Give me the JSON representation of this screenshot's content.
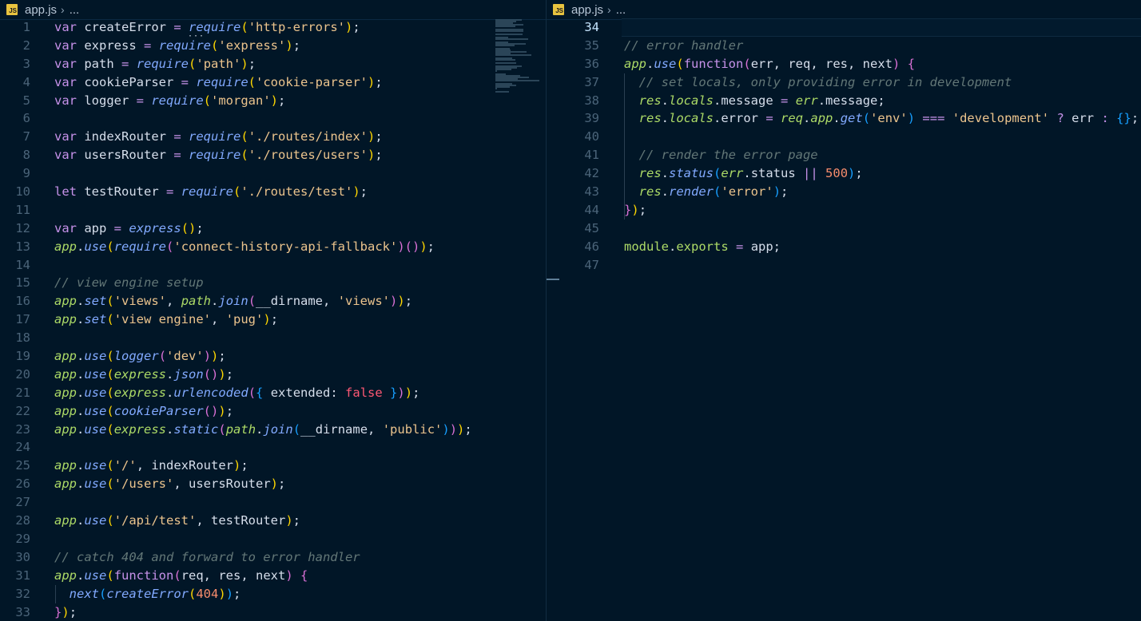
{
  "left_pane": {
    "breadcrumb": {
      "file": "app.js",
      "badge": "JS",
      "more": "..."
    },
    "first_line_number": 1,
    "lines": [
      [
        [
          "kw",
          "var"
        ],
        [
          "var",
          " createError "
        ],
        [
          "op",
          "="
        ],
        [
          "var",
          " "
        ],
        [
          "fn",
          "require"
        ],
        [
          "p1",
          "("
        ],
        [
          "str",
          "'http-errors'"
        ],
        [
          "p1",
          ")"
        ],
        [
          "var",
          ";"
        ]
      ],
      [
        [
          "kw",
          "var"
        ],
        [
          "var",
          " express "
        ],
        [
          "op",
          "="
        ],
        [
          "var",
          " "
        ],
        [
          "fn",
          "require"
        ],
        [
          "p1",
          "("
        ],
        [
          "str",
          "'express'"
        ],
        [
          "p1",
          ")"
        ],
        [
          "var",
          ";"
        ]
      ],
      [
        [
          "kw",
          "var"
        ],
        [
          "var",
          " path "
        ],
        [
          "op",
          "="
        ],
        [
          "var",
          " "
        ],
        [
          "fn",
          "require"
        ],
        [
          "p1",
          "("
        ],
        [
          "str",
          "'path'"
        ],
        [
          "p1",
          ")"
        ],
        [
          "var",
          ";"
        ]
      ],
      [
        [
          "kw",
          "var"
        ],
        [
          "var",
          " cookieParser "
        ],
        [
          "op",
          "="
        ],
        [
          "var",
          " "
        ],
        [
          "fn",
          "require"
        ],
        [
          "p1",
          "("
        ],
        [
          "str",
          "'cookie-parser'"
        ],
        [
          "p1",
          ")"
        ],
        [
          "var",
          ";"
        ]
      ],
      [
        [
          "kw",
          "var"
        ],
        [
          "var",
          " logger "
        ],
        [
          "op",
          "="
        ],
        [
          "var",
          " "
        ],
        [
          "fn",
          "require"
        ],
        [
          "p1",
          "("
        ],
        [
          "str",
          "'morgan'"
        ],
        [
          "p1",
          ")"
        ],
        [
          "var",
          ";"
        ]
      ],
      [],
      [
        [
          "kw",
          "var"
        ],
        [
          "var",
          " indexRouter "
        ],
        [
          "op",
          "="
        ],
        [
          "var",
          " "
        ],
        [
          "fn",
          "require"
        ],
        [
          "p1",
          "("
        ],
        [
          "str",
          "'./routes/index'"
        ],
        [
          "p1",
          ")"
        ],
        [
          "var",
          ";"
        ]
      ],
      [
        [
          "kw",
          "var"
        ],
        [
          "var",
          " usersRouter "
        ],
        [
          "op",
          "="
        ],
        [
          "var",
          " "
        ],
        [
          "fn",
          "require"
        ],
        [
          "p1",
          "("
        ],
        [
          "str",
          "'./routes/users'"
        ],
        [
          "p1",
          ")"
        ],
        [
          "var",
          ";"
        ]
      ],
      [],
      [
        [
          "kw",
          "let"
        ],
        [
          "var",
          " testRouter "
        ],
        [
          "op",
          "="
        ],
        [
          "var",
          " "
        ],
        [
          "fn",
          "require"
        ],
        [
          "p1",
          "("
        ],
        [
          "str",
          "'./routes/test'"
        ],
        [
          "p1",
          ")"
        ],
        [
          "var",
          ";"
        ]
      ],
      [],
      [
        [
          "kw",
          "var"
        ],
        [
          "var",
          " app "
        ],
        [
          "op",
          "="
        ],
        [
          "var",
          " "
        ],
        [
          "fn",
          "express"
        ],
        [
          "p1",
          "()"
        ],
        [
          "var",
          ";"
        ]
      ],
      [
        [
          "obj",
          "app"
        ],
        [
          "var",
          "."
        ],
        [
          "fn",
          "use"
        ],
        [
          "p1",
          "("
        ],
        [
          "fn",
          "require"
        ],
        [
          "p2",
          "("
        ],
        [
          "str",
          "'connect-history-api-fallback'"
        ],
        [
          "p2",
          ")()"
        ],
        [
          "p1",
          ")"
        ],
        [
          "var",
          ";"
        ]
      ],
      [],
      [
        [
          "cm",
          "// view engine setup"
        ]
      ],
      [
        [
          "obj",
          "app"
        ],
        [
          "var",
          "."
        ],
        [
          "fn",
          "set"
        ],
        [
          "p1",
          "("
        ],
        [
          "str",
          "'views'"
        ],
        [
          "var",
          ", "
        ],
        [
          "obj",
          "path"
        ],
        [
          "var",
          "."
        ],
        [
          "fn",
          "join"
        ],
        [
          "p2",
          "("
        ],
        [
          "var",
          "__dirname, "
        ],
        [
          "str",
          "'views'"
        ],
        [
          "p2",
          ")"
        ],
        [
          "p1",
          ")"
        ],
        [
          "var",
          ";"
        ]
      ],
      [
        [
          "obj",
          "app"
        ],
        [
          "var",
          "."
        ],
        [
          "fn",
          "set"
        ],
        [
          "p1",
          "("
        ],
        [
          "str",
          "'view engine'"
        ],
        [
          "var",
          ", "
        ],
        [
          "str",
          "'pug'"
        ],
        [
          "p1",
          ")"
        ],
        [
          "var",
          ";"
        ]
      ],
      [],
      [
        [
          "obj",
          "app"
        ],
        [
          "var",
          "."
        ],
        [
          "fn",
          "use"
        ],
        [
          "p1",
          "("
        ],
        [
          "fn",
          "logger"
        ],
        [
          "p2",
          "("
        ],
        [
          "str",
          "'dev'"
        ],
        [
          "p2",
          ")"
        ],
        [
          "p1",
          ")"
        ],
        [
          "var",
          ";"
        ]
      ],
      [
        [
          "obj",
          "app"
        ],
        [
          "var",
          "."
        ],
        [
          "fn",
          "use"
        ],
        [
          "p1",
          "("
        ],
        [
          "obj",
          "express"
        ],
        [
          "var",
          "."
        ],
        [
          "fn",
          "json"
        ],
        [
          "p2",
          "()"
        ],
        [
          "p1",
          ")"
        ],
        [
          "var",
          ";"
        ]
      ],
      [
        [
          "obj",
          "app"
        ],
        [
          "var",
          "."
        ],
        [
          "fn",
          "use"
        ],
        [
          "p1",
          "("
        ],
        [
          "obj",
          "express"
        ],
        [
          "var",
          "."
        ],
        [
          "fn",
          "urlencoded"
        ],
        [
          "p2",
          "("
        ],
        [
          "p3",
          "{"
        ],
        [
          "var",
          " extended: "
        ],
        [
          "bool",
          "false"
        ],
        [
          "var",
          " "
        ],
        [
          "p3",
          "}"
        ],
        [
          "p2",
          ")"
        ],
        [
          "p1",
          ")"
        ],
        [
          "var",
          ";"
        ]
      ],
      [
        [
          "obj",
          "app"
        ],
        [
          "var",
          "."
        ],
        [
          "fn",
          "use"
        ],
        [
          "p1",
          "("
        ],
        [
          "fn",
          "cookieParser"
        ],
        [
          "p2",
          "()"
        ],
        [
          "p1",
          ")"
        ],
        [
          "var",
          ";"
        ]
      ],
      [
        [
          "obj",
          "app"
        ],
        [
          "var",
          "."
        ],
        [
          "fn",
          "use"
        ],
        [
          "p1",
          "("
        ],
        [
          "obj",
          "express"
        ],
        [
          "var",
          "."
        ],
        [
          "fn",
          "static"
        ],
        [
          "p2",
          "("
        ],
        [
          "obj",
          "path"
        ],
        [
          "var",
          "."
        ],
        [
          "fn",
          "join"
        ],
        [
          "p3",
          "("
        ],
        [
          "var",
          "__dirname, "
        ],
        [
          "str",
          "'public'"
        ],
        [
          "p3",
          ")"
        ],
        [
          "p2",
          ")"
        ],
        [
          "p1",
          ")"
        ],
        [
          "var",
          ";"
        ]
      ],
      [],
      [
        [
          "obj",
          "app"
        ],
        [
          "var",
          "."
        ],
        [
          "fn",
          "use"
        ],
        [
          "p1",
          "("
        ],
        [
          "str",
          "'/'"
        ],
        [
          "var",
          ", indexRouter"
        ],
        [
          "p1",
          ")"
        ],
        [
          "var",
          ";"
        ]
      ],
      [
        [
          "obj",
          "app"
        ],
        [
          "var",
          "."
        ],
        [
          "fn",
          "use"
        ],
        [
          "p1",
          "("
        ],
        [
          "str",
          "'/users'"
        ],
        [
          "var",
          ", usersRouter"
        ],
        [
          "p1",
          ")"
        ],
        [
          "var",
          ";"
        ]
      ],
      [],
      [
        [
          "obj",
          "app"
        ],
        [
          "var",
          "."
        ],
        [
          "fn",
          "use"
        ],
        [
          "p1",
          "("
        ],
        [
          "str",
          "'/api/test'"
        ],
        [
          "var",
          ", testRouter"
        ],
        [
          "p1",
          ")"
        ],
        [
          "var",
          ";"
        ]
      ],
      [],
      [
        [
          "cm",
          "// catch 404 and forward to error handler"
        ]
      ],
      [
        [
          "obj",
          "app"
        ],
        [
          "var",
          "."
        ],
        [
          "fn",
          "use"
        ],
        [
          "p1",
          "("
        ],
        [
          "kw",
          "function"
        ],
        [
          "p2",
          "("
        ],
        [
          "var",
          "req, res, next"
        ],
        [
          "p2",
          ")"
        ],
        [
          "var",
          " "
        ],
        [
          "p2",
          "{"
        ]
      ],
      [
        [
          "var",
          "  "
        ],
        [
          "fn",
          "next"
        ],
        [
          "p3",
          "("
        ],
        [
          "fn",
          "createError"
        ],
        [
          "p1",
          "("
        ],
        [
          "num",
          "404"
        ],
        [
          "p1",
          ")"
        ],
        [
          "p3",
          ")"
        ],
        [
          "var",
          ";"
        ]
      ],
      [
        [
          "p2",
          "}"
        ],
        [
          "p1",
          ")"
        ],
        [
          "var",
          ";"
        ]
      ]
    ]
  },
  "right_pane": {
    "breadcrumb": {
      "file": "app.js",
      "badge": "JS",
      "more": "..."
    },
    "first_line_number": 34,
    "active_line_number": 34,
    "lines": [
      [],
      [
        [
          "cm",
          "// error handler"
        ]
      ],
      [
        [
          "obj",
          "app"
        ],
        [
          "var",
          "."
        ],
        [
          "fn",
          "use"
        ],
        [
          "p1",
          "("
        ],
        [
          "kw",
          "function"
        ],
        [
          "p2",
          "("
        ],
        [
          "var",
          "err, req, res, next"
        ],
        [
          "p2",
          ")"
        ],
        [
          "var",
          " "
        ],
        [
          "p2",
          "{"
        ]
      ],
      [
        [
          "var",
          "  "
        ],
        [
          "cm",
          "// set locals, only providing error in development"
        ]
      ],
      [
        [
          "var",
          "  "
        ],
        [
          "obj",
          "res"
        ],
        [
          "var",
          "."
        ],
        [
          "obj",
          "locals"
        ],
        [
          "var",
          ".message "
        ],
        [
          "op",
          "="
        ],
        [
          "var",
          " "
        ],
        [
          "obj",
          "err"
        ],
        [
          "var",
          ".message;"
        ]
      ],
      [
        [
          "var",
          "  "
        ],
        [
          "obj",
          "res"
        ],
        [
          "var",
          "."
        ],
        [
          "obj",
          "locals"
        ],
        [
          "var",
          ".error "
        ],
        [
          "op",
          "="
        ],
        [
          "var",
          " "
        ],
        [
          "obj",
          "req"
        ],
        [
          "var",
          "."
        ],
        [
          "obj",
          "app"
        ],
        [
          "var",
          "."
        ],
        [
          "fn",
          "get"
        ],
        [
          "p3",
          "("
        ],
        [
          "str",
          "'env'"
        ],
        [
          "p3",
          ")"
        ],
        [
          "var",
          " "
        ],
        [
          "op",
          "==="
        ],
        [
          "var",
          " "
        ],
        [
          "str",
          "'development'"
        ],
        [
          "var",
          " "
        ],
        [
          "op",
          "?"
        ],
        [
          "var",
          " err "
        ],
        [
          "op",
          ":"
        ],
        [
          "var",
          " "
        ],
        [
          "p3",
          "{}"
        ],
        [
          "var",
          ";"
        ]
      ],
      [],
      [
        [
          "var",
          "  "
        ],
        [
          "cm",
          "// render the error page"
        ]
      ],
      [
        [
          "var",
          "  "
        ],
        [
          "obj",
          "res"
        ],
        [
          "var",
          "."
        ],
        [
          "fn",
          "status"
        ],
        [
          "p3",
          "("
        ],
        [
          "obj",
          "err"
        ],
        [
          "var",
          ".status "
        ],
        [
          "op",
          "||"
        ],
        [
          "var",
          " "
        ],
        [
          "num",
          "500"
        ],
        [
          "p3",
          ")"
        ],
        [
          "var",
          ";"
        ]
      ],
      [
        [
          "var",
          "  "
        ],
        [
          "obj",
          "res"
        ],
        [
          "var",
          "."
        ],
        [
          "fn",
          "render"
        ],
        [
          "p3",
          "("
        ],
        [
          "str",
          "'error'"
        ],
        [
          "p3",
          ")"
        ],
        [
          "var",
          ";"
        ]
      ],
      [
        [
          "p2",
          "}"
        ],
        [
          "p1",
          ")"
        ],
        [
          "var",
          ";"
        ]
      ],
      [],
      [
        [
          "mod",
          "module"
        ],
        [
          "var",
          "."
        ],
        [
          "mod",
          "exports"
        ],
        [
          "var",
          " "
        ],
        [
          "op",
          "="
        ],
        [
          "var",
          " app;"
        ]
      ],
      []
    ]
  }
}
